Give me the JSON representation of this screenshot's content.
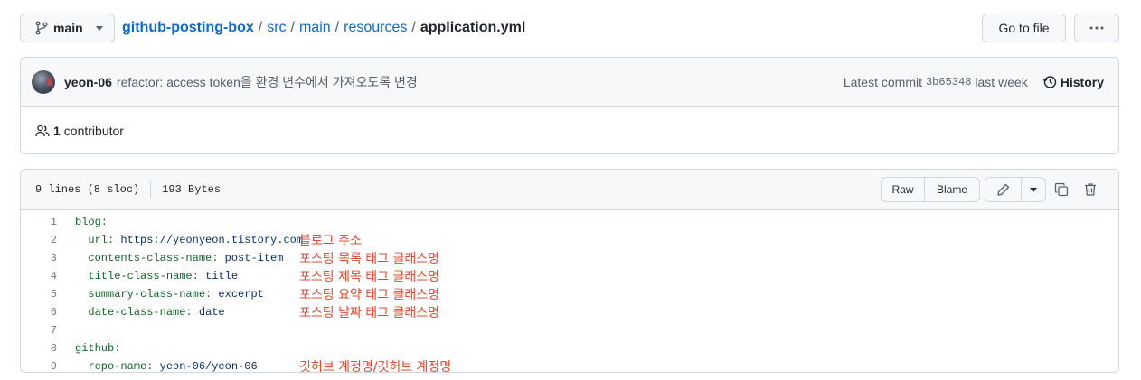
{
  "topbar": {
    "branch": "main",
    "breadcrumbs": [
      {
        "label": "github-posting-box",
        "kind": "repo"
      },
      {
        "label": "src",
        "kind": "dir"
      },
      {
        "label": "main",
        "kind": "dir"
      },
      {
        "label": "resources",
        "kind": "dir"
      }
    ],
    "separator": "/",
    "file_name": "application.yml",
    "goto_label": "Go to file",
    "more_label": "···"
  },
  "commit": {
    "author": "yeon-06",
    "message": "refactor: access token을 환경 변수에서 가져오도록 변경",
    "latest_prefix": "Latest commit",
    "sha": "3b65348",
    "when": "last week",
    "history_label": "History"
  },
  "contributors": {
    "count": "1",
    "label": "contributor"
  },
  "file": {
    "lines_info": "9 lines (8 sloc)",
    "size": "193 Bytes",
    "raw_label": "Raw",
    "blame_label": "Blame",
    "lines": [
      {
        "n": "1",
        "indent": "",
        "key": "blog:",
        "value": "",
        "note": ""
      },
      {
        "n": "2",
        "indent": "  ",
        "key": "url:",
        "value": " https://yeonyeon.tistory.com",
        "note": "블로그 주소"
      },
      {
        "n": "3",
        "indent": "  ",
        "key": "contents-class-name:",
        "value": " post-item",
        "note": "포스팅 목록 태그 클래스명"
      },
      {
        "n": "4",
        "indent": "  ",
        "key": "title-class-name:",
        "value": " title",
        "note": "포스팅 제목 태그 클래스명"
      },
      {
        "n": "5",
        "indent": "  ",
        "key": "summary-class-name:",
        "value": " excerpt",
        "note": "포스팅 요약 태그 클래스명"
      },
      {
        "n": "6",
        "indent": "  ",
        "key": "date-class-name:",
        "value": " date",
        "note": "포스팅 날짜 태그 클래스명"
      },
      {
        "n": "7",
        "indent": "",
        "key": "",
        "value": "",
        "note": ""
      },
      {
        "n": "8",
        "indent": "",
        "key": "github:",
        "value": "",
        "note": ""
      },
      {
        "n": "9",
        "indent": "  ",
        "key": "repo-name:",
        "value": " yeon-06/yeon-06",
        "note": "깃허브 계정명/깃허브 계정명"
      }
    ]
  },
  "colors": {
    "link": "#0969da",
    "annotation": "#e5482d",
    "yaml_key": "#116329",
    "yaml_value": "#0a3069"
  }
}
